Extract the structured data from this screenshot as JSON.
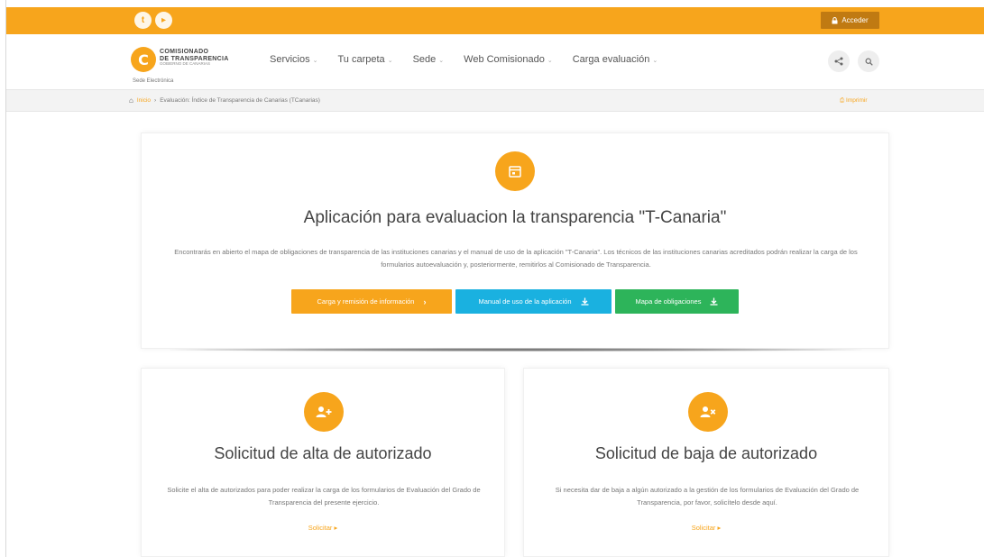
{
  "topbar": {
    "social": [
      {
        "icon": "twitter-icon",
        "glyph": "t"
      },
      {
        "icon": "youtube-icon",
        "glyph": "▸"
      }
    ],
    "login_label": "Acceder",
    "accent": "#f7a51c"
  },
  "header": {
    "logo_line1": "COMISIONADO",
    "logo_line2": "DE TRANSPARENCIA",
    "logo_line3": "GOBIERNO DE CANARIAS",
    "logo_glyph": "C",
    "sede_label": "Sede Electrónica",
    "nav": [
      {
        "label": "Servicios"
      },
      {
        "label": "Tu carpeta"
      },
      {
        "label": "Sede"
      },
      {
        "label": "Web Comisionado"
      },
      {
        "label": "Carga evaluación"
      }
    ],
    "share_icon": "share-icon",
    "search_icon": "search-icon"
  },
  "breadcrumb": {
    "home_label": "Inicio",
    "current": "Evaluación: Índice de Transparencia de Canarias (TCanarias)",
    "print_label": "Imprimir"
  },
  "main_card": {
    "icon": "calendar-icon",
    "title": "Aplicación para evaluacion la transparencia \"T-Canaria\"",
    "description": "Encontrarás en abierto el mapa de obligaciones de transparencia de las instituciones canarias y el manual de uso de la aplicación \"T-Canaria\". Los técnicos de las instituciones canarias acreditados podrán realizar la carga de los formularios autoevaluación y, posteriormente, remitirlos al Comisionado de Transparencia.",
    "buttons": [
      {
        "label": "Carga y remisión de información",
        "icon": "arrow-right-icon",
        "color": "#f7a51c"
      },
      {
        "label": "Manual de uso de la aplicación",
        "icon": "download-icon",
        "color": "#1ab1e0"
      },
      {
        "label": "Mapa de obligaciones",
        "icon": "download-icon",
        "color": "#2db45a"
      }
    ]
  },
  "alta_card": {
    "icon": "add-user-icon",
    "title": "Solicitud de alta de autorizado",
    "description": "Solicite el alta de autorizados para poder realizar la carga de los formularios de Evaluación del Grado de Transparencia del presente ejercicio.",
    "link_label": "Solicitar ▸"
  },
  "baja_card": {
    "icon": "remove-user-icon",
    "title": "Solicitud de baja de autorizado",
    "description": "Si necesita dar de baja a algún autorizado a la gestión de los formularios de Evaluación del Grado de Transparencia, por favor, solicítelo desde aquí.",
    "link_label": "Solicitar ▸"
  }
}
